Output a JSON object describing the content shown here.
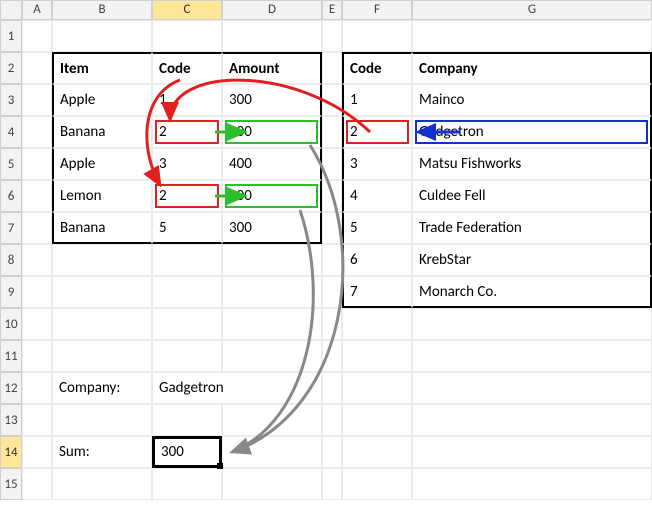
{
  "columns": [
    "A",
    "B",
    "C",
    "D",
    "E",
    "F",
    "G"
  ],
  "rows": [
    "1",
    "2",
    "3",
    "4",
    "5",
    "6",
    "7",
    "8",
    "9",
    "10",
    "11",
    "12",
    "13",
    "14",
    "15"
  ],
  "active_col_index": 2,
  "active_row_index": 13,
  "left": {
    "headers": {
      "item": "Item",
      "code": "Code",
      "amount": "Amount"
    },
    "data": [
      {
        "item": "Apple",
        "code": "1",
        "amount": "300"
      },
      {
        "item": "Banana",
        "code": "2",
        "amount": "200"
      },
      {
        "item": "Apple",
        "code": "3",
        "amount": "400"
      },
      {
        "item": "Lemon",
        "code": "2",
        "amount": "100"
      },
      {
        "item": "Banana",
        "code": "5",
        "amount": "300"
      }
    ]
  },
  "right": {
    "headers": {
      "code": "Code",
      "company": "Company"
    },
    "data": [
      {
        "code": "1",
        "company": "Mainco"
      },
      {
        "code": "2",
        "company": "Gadgetron"
      },
      {
        "code": "3",
        "company": "Matsu Fishworks"
      },
      {
        "code": "4",
        "company": "Culdee Fell"
      },
      {
        "code": "5",
        "company": "Trade Federation"
      },
      {
        "code": "6",
        "company": "KrebStar"
      },
      {
        "code": "7",
        "company": "Monarch Co."
      }
    ]
  },
  "lookup": {
    "company_label": "Company:",
    "company_value": "Gadgetron",
    "sum_label": "Sum:",
    "sum_value": "300"
  }
}
